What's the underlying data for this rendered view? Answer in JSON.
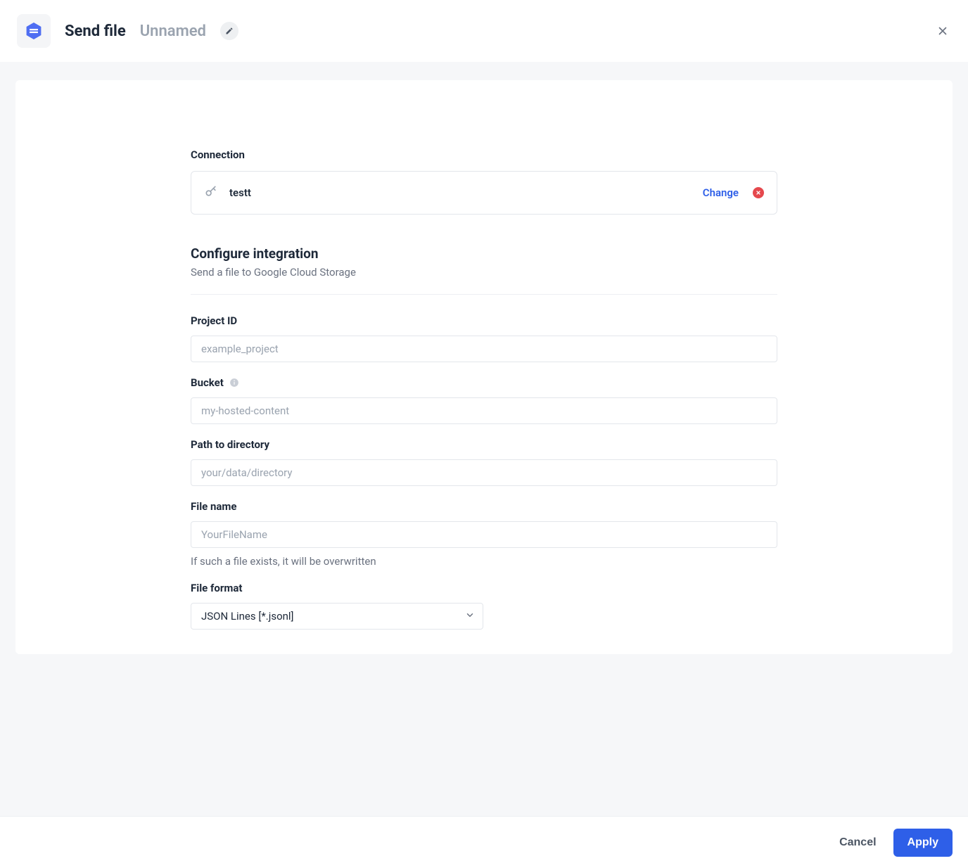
{
  "header": {
    "title": "Send file",
    "subtitle": "Unnamed"
  },
  "connection": {
    "heading": "Connection",
    "name": "testt",
    "change_label": "Change"
  },
  "integration": {
    "title": "Configure integration",
    "desc": "Send a file to Google Cloud Storage"
  },
  "fields": {
    "project_id": {
      "label": "Project ID",
      "placeholder": "example_project",
      "value": ""
    },
    "bucket": {
      "label": "Bucket",
      "placeholder": "my-hosted-content",
      "value": ""
    },
    "path": {
      "label": "Path to directory",
      "placeholder": "your/data/directory",
      "value": ""
    },
    "filename": {
      "label": "File name",
      "placeholder": "YourFileName",
      "value": "",
      "help": "If such a file exists, it will be overwritten"
    },
    "format": {
      "label": "File format",
      "selected": "JSON Lines [*.jsonl]"
    }
  },
  "footer": {
    "cancel": "Cancel",
    "apply": "Apply"
  }
}
